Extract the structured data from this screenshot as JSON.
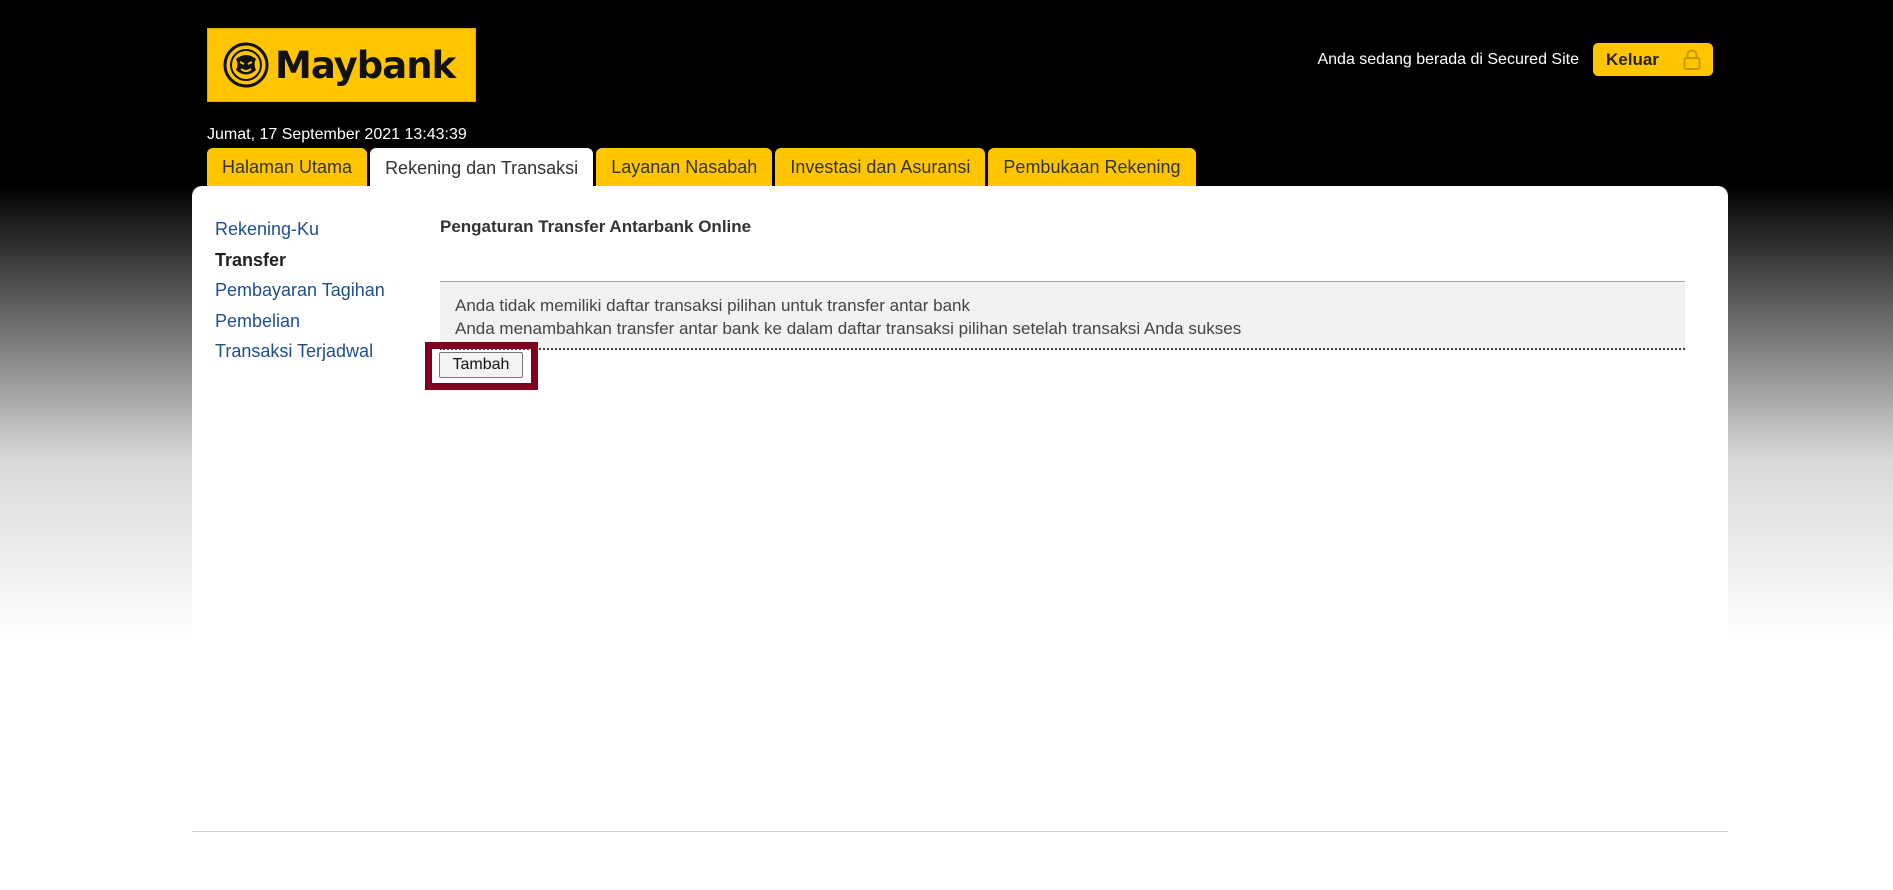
{
  "header": {
    "logo_text": "Maybank",
    "logo_icon": "tiger-head-icon",
    "secured_text": "Anda sedang berada di Secured Site",
    "logout_label": "Keluar",
    "logout_icon": "lock-icon",
    "datetime": "Jumat, 17 September 2021 13:43:39"
  },
  "tabs": [
    {
      "label": "Halaman Utama",
      "active": false
    },
    {
      "label": "Rekening dan Transaksi",
      "active": true
    },
    {
      "label": "Layanan Nasabah",
      "active": false
    },
    {
      "label": "Investasi dan Asuransi",
      "active": false
    },
    {
      "label": "Pembukaan Rekening",
      "active": false
    }
  ],
  "sidebar": {
    "items": [
      {
        "label": "Rekening-Ku",
        "active": false
      },
      {
        "label": "Transfer",
        "active": true
      },
      {
        "label": "Pembayaran Tagihan",
        "active": false
      },
      {
        "label": "Pembelian",
        "active": false
      },
      {
        "label": "Transaksi Terjadwal",
        "active": false
      }
    ]
  },
  "main": {
    "title": "Pengaturan Transfer Antarbank Online",
    "info_lines": [
      "Anda tidak memiliki daftar transaksi pilihan untuk transfer antar bank",
      "Anda menambahkan transfer antar bank ke dalam daftar transaksi pilihan setelah transaksi Anda sukses"
    ],
    "add_button_label": "Tambah"
  },
  "colors": {
    "brand_yellow": "#ffc600",
    "link_blue": "#1f4e8c",
    "highlight_maroon": "#800020"
  }
}
